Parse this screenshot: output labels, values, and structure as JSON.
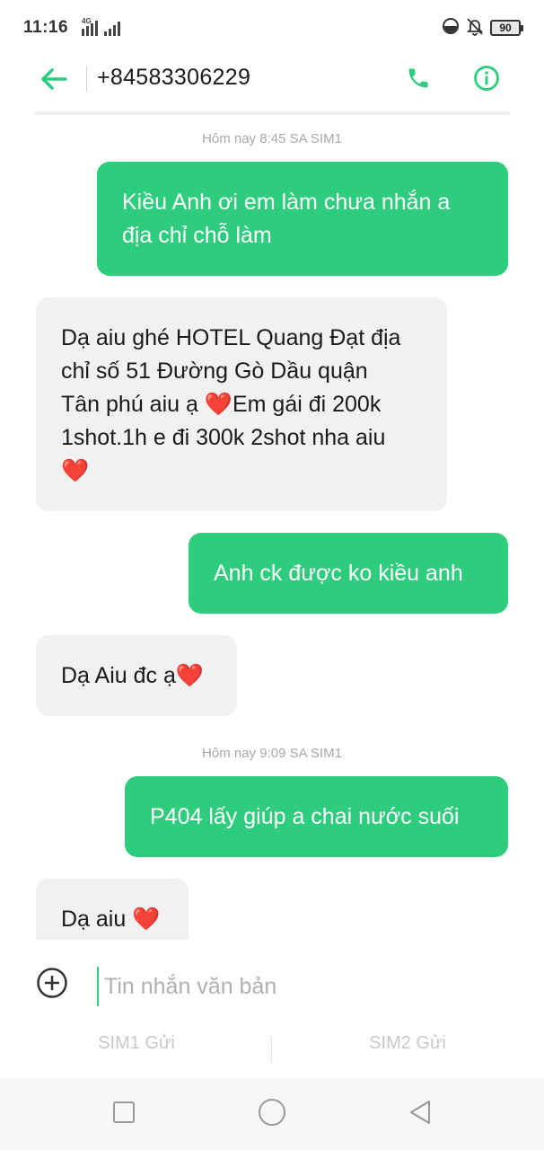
{
  "status_bar": {
    "time": "11:16",
    "network_tag": "4G",
    "battery": "90"
  },
  "header": {
    "contact": "+84583306229"
  },
  "conversation": {
    "timestamps": [
      "Hôm nay 8:45 SA  SIM1",
      "Hôm nay 9:09 SA  SIM1"
    ],
    "messages": [
      {
        "direction": "out",
        "lines": [
          "Kiều Anh ơi em làm chưa nhắn a",
          "địa chỉ chỗ làm"
        ]
      },
      {
        "direction": "in",
        "lines": [
          "Dạ aiu ghé HOTEL Quang Đạt địa",
          "chỉ số 51 Đường Gò Dầu quận",
          "Tân phú aiu ạ ❤️Em gái đi 200k",
          "1shot.1h e đi 300k 2shot nha aiu",
          "❤️"
        ]
      },
      {
        "direction": "out",
        "lines": [
          "Anh ck được ko kiều anh"
        ]
      },
      {
        "direction": "in",
        "lines": [
          "Dạ Aiu đc ạ❤️"
        ]
      },
      {
        "direction": "out",
        "lines": [
          "P404 lấy giúp a chai nước suối"
        ]
      },
      {
        "direction": "in",
        "lines": [
          "Dạ aiu ❤️"
        ]
      }
    ]
  },
  "composer": {
    "placeholder": "Tin nhắn văn bản",
    "sim1_send": "SIM1 Gửi",
    "sim2_send": "SIM2 Gửi"
  },
  "colors": {
    "accent": "#2ecc7d",
    "incoming_bubble": "#f1f1f1",
    "timestamp": "#a8a8a8"
  },
  "icons": {
    "back": "arrow-left-icon",
    "call": "phone-icon",
    "info": "info-icon",
    "add": "plus-circle-icon",
    "nav_recents": "square-icon",
    "nav_home": "circle-icon",
    "nav_back": "triangle-back-icon"
  }
}
